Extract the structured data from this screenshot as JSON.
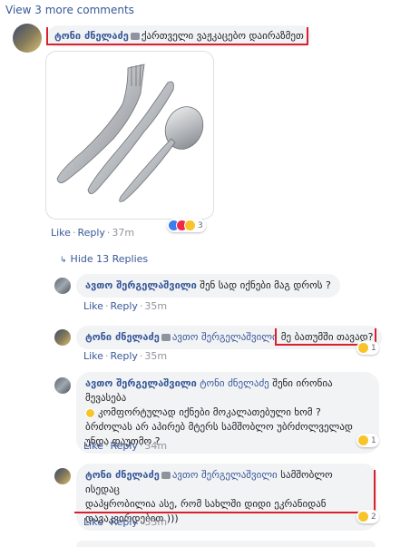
{
  "view_more": "View 3 more comments",
  "comment_main": {
    "author": "ტონი ძნელაძე",
    "text": "ქართველი ვაჟკაცებო დაირაზმეთ",
    "actions": {
      "like": "Like",
      "reply": "Reply",
      "time": "37m"
    },
    "reaction_count": "3"
  },
  "hide_replies": "Hide 13 Replies",
  "replies": [
    {
      "author": "ავთო შერგელაშვილი",
      "text": "შენ სად იქნები მაგ დროს ?",
      "actions": {
        "like": "Like",
        "reply": "Reply",
        "time": "35m"
      }
    },
    {
      "author": "ტონი ძნელაძე",
      "tag": "ავთო შერგელაშვილი",
      "text": "მე ბათუმში თავად?",
      "actions": {
        "like": "Like",
        "reply": "Reply",
        "time": "35m"
      },
      "reaction_count": "1"
    },
    {
      "author": "ავთო შერგელაშვილი",
      "tag": "ტონი ძნელაძე",
      "text_line1": "შენი ირონია მევასება",
      "text_line2": "კომფორტულად იქნები მოკალათებული ხომ ?",
      "text_line3": "ბრძოლას არ აპირებ მტერს სამშობლო უბრძოლველად",
      "text_line4": "უნდა დაუთმო ?",
      "actions": {
        "like": "Like",
        "reply": "Reply",
        "time": "34m"
      },
      "reaction_count": "1"
    },
    {
      "author": "ტონი ძნელაძე",
      "tag": "ავთო შერგელაშვილი",
      "text_line1": "სამშობლო ისედაც",
      "text_line2": "დაპყრობილია ასე, რომ სახლში დიდი ეკრანიდან",
      "text_line3": "დავაკვირდებით )))",
      "actions": {
        "like": "Like",
        "reply": "Reply",
        "time": "33m"
      },
      "reaction_count": "2"
    }
  ],
  "colors": {
    "link": "#385898",
    "bubble": "#f2f3f5",
    "annotation": "#d8202f"
  }
}
